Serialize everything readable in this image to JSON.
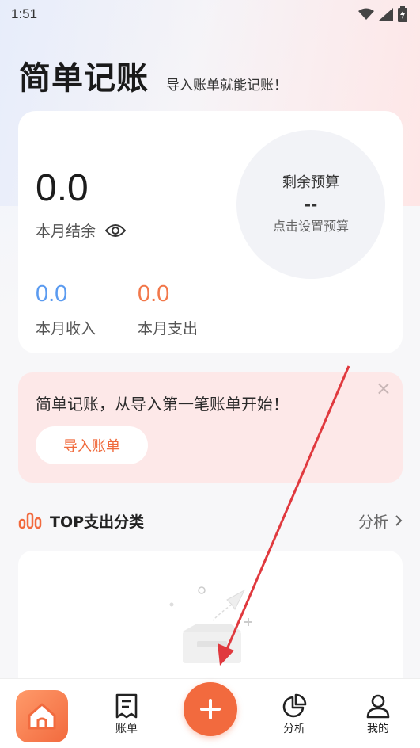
{
  "status_bar": {
    "time": "1:51"
  },
  "header": {
    "title": "简单记账",
    "subtitle": "导入账单就能记账！"
  },
  "summary": {
    "balance_value": "0.0",
    "balance_label": "本月结余",
    "budget_title": "剩余预算",
    "budget_value": "--",
    "budget_hint": "点击设置预算",
    "income_value": "0.0",
    "income_label": "本月收入",
    "expense_value": "0.0",
    "expense_label": "本月支出",
    "income_color": "#5b9bf0",
    "expense_color": "#f2784b"
  },
  "banner": {
    "text": "简单记账，从导入第一笔账单开始！",
    "button_label": "导入账单",
    "close_symbol": "×"
  },
  "top_expense": {
    "title": "TOP支出分类",
    "link_label": "分析"
  },
  "tab_bar": {
    "tabs": [
      {
        "label": "",
        "icon": "home-icon"
      },
      {
        "label": "账单",
        "icon": "bill-icon"
      },
      {
        "label": "",
        "icon": "plus-icon"
      },
      {
        "label": "分析",
        "icon": "pie-chart-icon"
      },
      {
        "label": "我的",
        "icon": "person-icon"
      }
    ]
  },
  "colors": {
    "accent": "#f26a3e",
    "annotation_arrow": "#e0393e"
  }
}
